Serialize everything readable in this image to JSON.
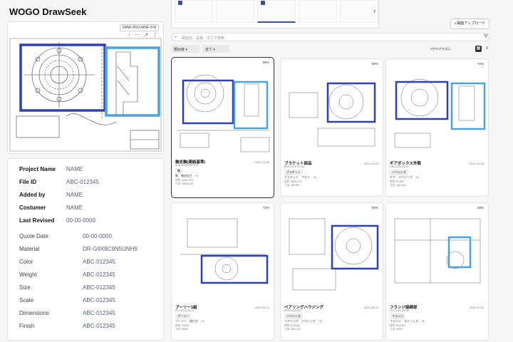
{
  "app_title": "WOGO DrawSeek",
  "preview": {
    "id_label": "DRW-2023-MNF-078",
    "tools": [
      "↓",
      "⋯",
      "↗",
      "⋮"
    ]
  },
  "meta_bold": [
    {
      "key": "Project Name",
      "value": "NAME"
    },
    {
      "key": "File ID",
      "value": "ABC-012345"
    },
    {
      "key": "Added by",
      "value": "NAME"
    },
    {
      "key": "Costumer",
      "value": "NAME"
    },
    {
      "key": "Last Revised",
      "value": "00-00-0000"
    }
  ],
  "meta_plain": [
    {
      "key": "Quote Date",
      "value": "00-00-0000"
    },
    {
      "key": "Material",
      "value": "DR-G9X8C9N5UNH9"
    },
    {
      "key": "Color",
      "value": "ABC-012345"
    },
    {
      "key": "Weight",
      "value": "ABC-012345"
    },
    {
      "key": "Size",
      "value": "ABC-012345"
    },
    {
      "key": "Scale",
      "value": "ABC-012345"
    },
    {
      "key": "Dimensions",
      "value": "ABC-012345"
    },
    {
      "key": "Finish",
      "value": "ABC-012345"
    }
  ],
  "toolbar": {
    "upload_label": "図面アップロード",
    "search_placeholder": "図面名、品番、タグで検索...",
    "sort_label": "類似度",
    "filter_label": "全て",
    "count_label": "6件中6件を表示"
  },
  "cards": [
    {
      "score": "86%",
      "title": "軸支軸(連結基準)",
      "sub": "SHA-2023-RMF-518",
      "date": "2024-12-08",
      "tag": "軸",
      "tags2": "軸　軸成加工　+1",
      "info1": "材質: S45C-H25",
      "info2": "寸法: Φ305×180"
    },
    {
      "score": "80%",
      "title": "ブラケット部品",
      "sub": "BRK-2023-TY-042",
      "date": "2024-11-16",
      "tag": "ブラケット",
      "tags2": "ブラケット　アルミ　+1",
      "info1": "材質: A5052-T6",
      "info2": "寸法: 150×80"
    },
    {
      "score": "72%",
      "title": "ギアボックス外殻",
      "sub": "GBX-2023-W-K4",
      "date": "2024-10-28",
      "tag": "ハウジング",
      "tags2": "ギア　ハウジング　+1",
      "info1": "材質: FC250",
      "info2": "寸法: 320×240"
    },
    {
      "score": "72%",
      "title": "プーリー1組",
      "sub": "PLY-2023-CB-12",
      "date": "2024-09-14",
      "tag": "プーリー",
      "tags2": "プーリー　歯付き　+1",
      "info1": "材質: SS400",
      "info2": "寸法: Φ180"
    },
    {
      "score": "80%",
      "title": "ベアリングハウジング",
      "sub": "BRG-2023-RJ-7",
      "date": "2024-08-20",
      "tag": "ハウジング",
      "tags2": "ベアリング　ハウジング　+1",
      "info1": "材質: FCD450",
      "info2": "寸法: 260×120"
    },
    {
      "score": "45%",
      "title": "フランジ接続部",
      "sub": "FLG-2023-SS-09",
      "date": "2024-07-03",
      "tag": "フランジ",
      "tags2": "フランジ　ステンレス　+1",
      "info1": "材質: SUS304",
      "info2": "寸法: Φ220"
    }
  ],
  "colors": {
    "box_dark": "#2d3fba",
    "box_light": "#4aa3df",
    "accent": "#3b4fa0"
  }
}
